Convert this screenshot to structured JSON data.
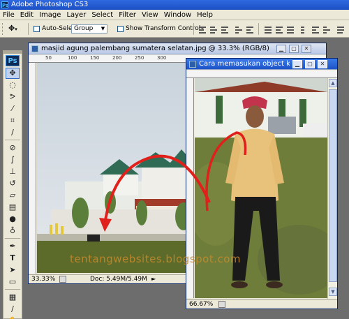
{
  "app": {
    "title": "Adobe Photoshop CS3",
    "logo": "Ps"
  },
  "menu": [
    "File",
    "Edit",
    "Image",
    "Layer",
    "Select",
    "Filter",
    "View",
    "Window",
    "Help"
  ],
  "options": {
    "auto_select_label": "Auto-Select:",
    "auto_select_checked": false,
    "auto_select_value": "Group",
    "show_transform_label": "Show Transform Controls",
    "show_transform_checked": false
  },
  "tools": [
    "move-tool",
    "marquee-tool",
    "lasso-tool",
    "magic-wand-tool",
    "crop-tool",
    "eyedropper-tool",
    "healing-brush-tool",
    "brush-tool",
    "clone-stamp-tool",
    "history-brush-tool",
    "eraser-tool",
    "gradient-tool",
    "blur-tool",
    "dodge-tool",
    "pen-tool",
    "type-tool",
    "path-selection-tool",
    "shape-tool",
    "notes-tool",
    "eyedropper-alt-tool",
    "hand-tool"
  ],
  "doc1": {
    "title": "masjid agung palembang sumatera selatan.jpg @ 33.3% (RGB/8)",
    "zoom": "33.33%",
    "status": "Doc: 5.49M/5.49M",
    "ruler_ticks": [
      "50",
      "100",
      "150",
      "200",
      "250",
      "300"
    ]
  },
  "doc2": {
    "title": "Cara memasukan object ke d...",
    "zoom": "66.67%"
  },
  "watermark": "tentangwebsites.blogspot.com",
  "colors": {
    "titlebar": "#1c4fc4",
    "chrome": "#ece9d8",
    "arrow": "#e0201a"
  }
}
